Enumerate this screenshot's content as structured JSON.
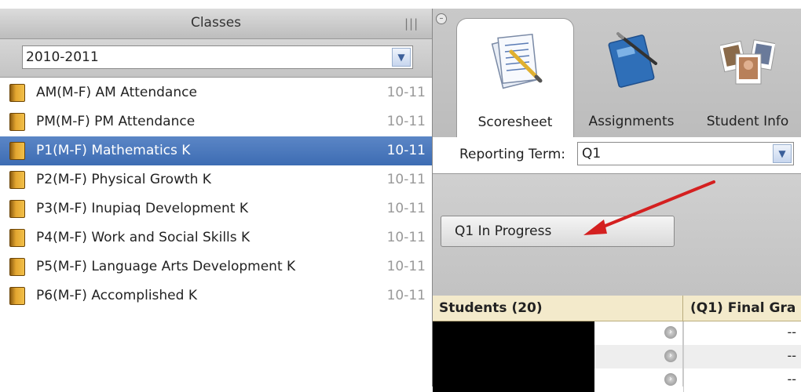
{
  "classes_panel": {
    "title": "Classes",
    "grip": "|||",
    "year_selected": "2010-2011",
    "items": [
      {
        "label": "AM(M-F) AM Attendance",
        "term": "10-11"
      },
      {
        "label": "PM(M-F) PM Attendance",
        "term": "10-11"
      },
      {
        "label": "P1(M-F) Mathematics K",
        "term": "10-11"
      },
      {
        "label": "P2(M-F) Physical Growth K",
        "term": "10-11"
      },
      {
        "label": "P3(M-F) Inupiaq Development K",
        "term": "10-11"
      },
      {
        "label": "P4(M-F) Work and Social Skills K",
        "term": "10-11"
      },
      {
        "label": "P5(M-F) Language Arts Development K",
        "term": "10-11"
      },
      {
        "label": "P6(M-F) Accomplished K",
        "term": "10-11"
      }
    ],
    "selected_index": 2
  },
  "tabs": [
    {
      "label": "Scoresheet",
      "icon": "scoresheet-icon",
      "active": true
    },
    {
      "label": "Assignments",
      "icon": "notebook-icon",
      "active": false
    },
    {
      "label": "Student Info",
      "icon": "student-photos-icon",
      "active": false
    }
  ],
  "reporting": {
    "label": "Reporting Term:",
    "selected": "Q1"
  },
  "progress_button": "Q1 In Progress",
  "grid": {
    "students_header": "Students (20)",
    "final_header": "(Q1) Final Gra",
    "rows": [
      {
        "value": "--"
      },
      {
        "value": "--"
      },
      {
        "value": "--"
      }
    ]
  },
  "colors": {
    "selection": "#4a77bd",
    "grid_header": "#f3eacb",
    "arrow": "#d42020"
  }
}
